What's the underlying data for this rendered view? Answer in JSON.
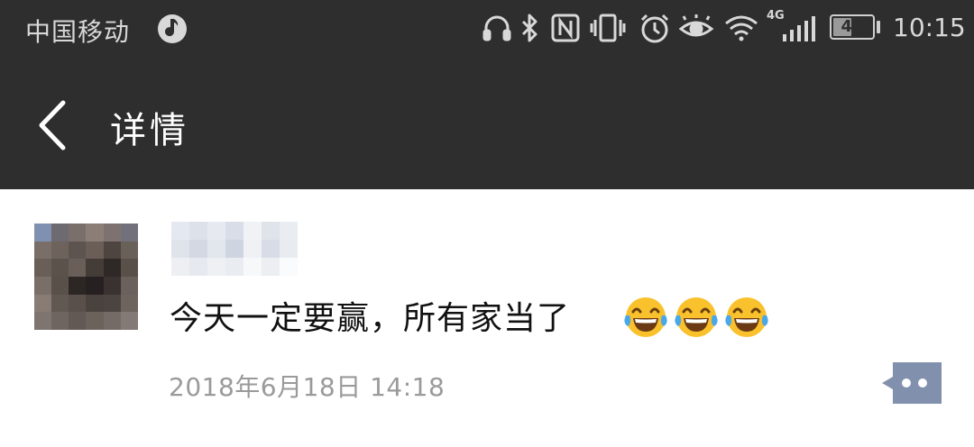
{
  "status_bar": {
    "carrier": "中国移动",
    "network": "4G",
    "battery": "47",
    "battery_level": 0.47,
    "time": "10:15",
    "icons": [
      "music-icon",
      "headphones-icon",
      "bluetooth-icon",
      "nfc-icon",
      "vibrate-icon",
      "alarm-icon",
      "eye-icon",
      "wifi-icon",
      "signal-icon",
      "battery-icon"
    ]
  },
  "nav": {
    "title": "详情",
    "back_icon": "chevron-left-icon"
  },
  "post": {
    "message": "今天一定要赢，所有家当了",
    "emojis": [
      "tears-of-joy-emoji",
      "tears-of-joy-emoji",
      "tears-of-joy-emoji"
    ],
    "timestamp": "2018年6月18日  14:18",
    "more_icon": "comment-more-icon"
  },
  "colors": {
    "bar_bg": "#2e2e2e",
    "timestamp": "#9a9a9a",
    "more_button": "#8191ad"
  }
}
